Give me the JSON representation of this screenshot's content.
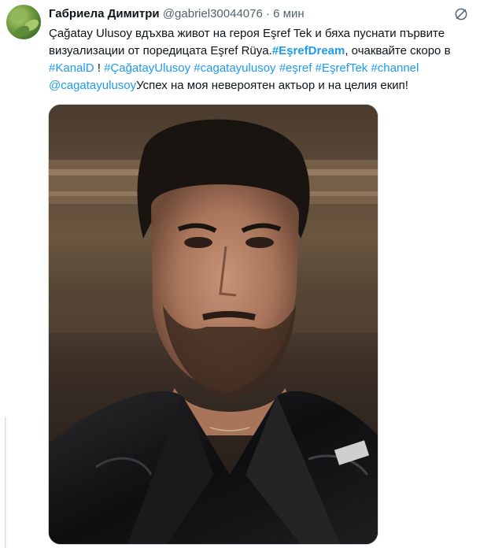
{
  "post": {
    "author_name": "Габриела Димитри",
    "author_handle": "@gabriel30044076",
    "separator": "·",
    "time_ago": "6 мин",
    "text_part1": "Çağatay Ulusoy вдъхва живот на героя Eşref Tek и бяха пуснати първите визуализации от поредицата Eşref Rüya.",
    "hashtag_eşrefdream": "#EşrefDream",
    "text_part2": ", очаквайте скоро в ",
    "hashtag_kanald": "#KanalD",
    "text_part3": " ! ",
    "hashtag_cagatayulusoy": "#ÇağatayUlusoy",
    "hashtag_cagatayulusoy_lower": "#cagatayulusoy",
    "hashtag_esref": "#eşref",
    "hashtag_esreftek": "#EşrefTek",
    "hashtag_channel": "#channel",
    "mention": "@cagatayulusoy",
    "text_part4": "Успех на моя невероятен актьор и на целия екип!"
  },
  "icons": {
    "avatar": "avatar-image",
    "grok": "grok-icon",
    "media": "photo-portrait"
  },
  "colors": {
    "link": "#1d9bf0",
    "text": "#0f1419",
    "secondary": "#536471",
    "border": "#cfd9de"
  }
}
